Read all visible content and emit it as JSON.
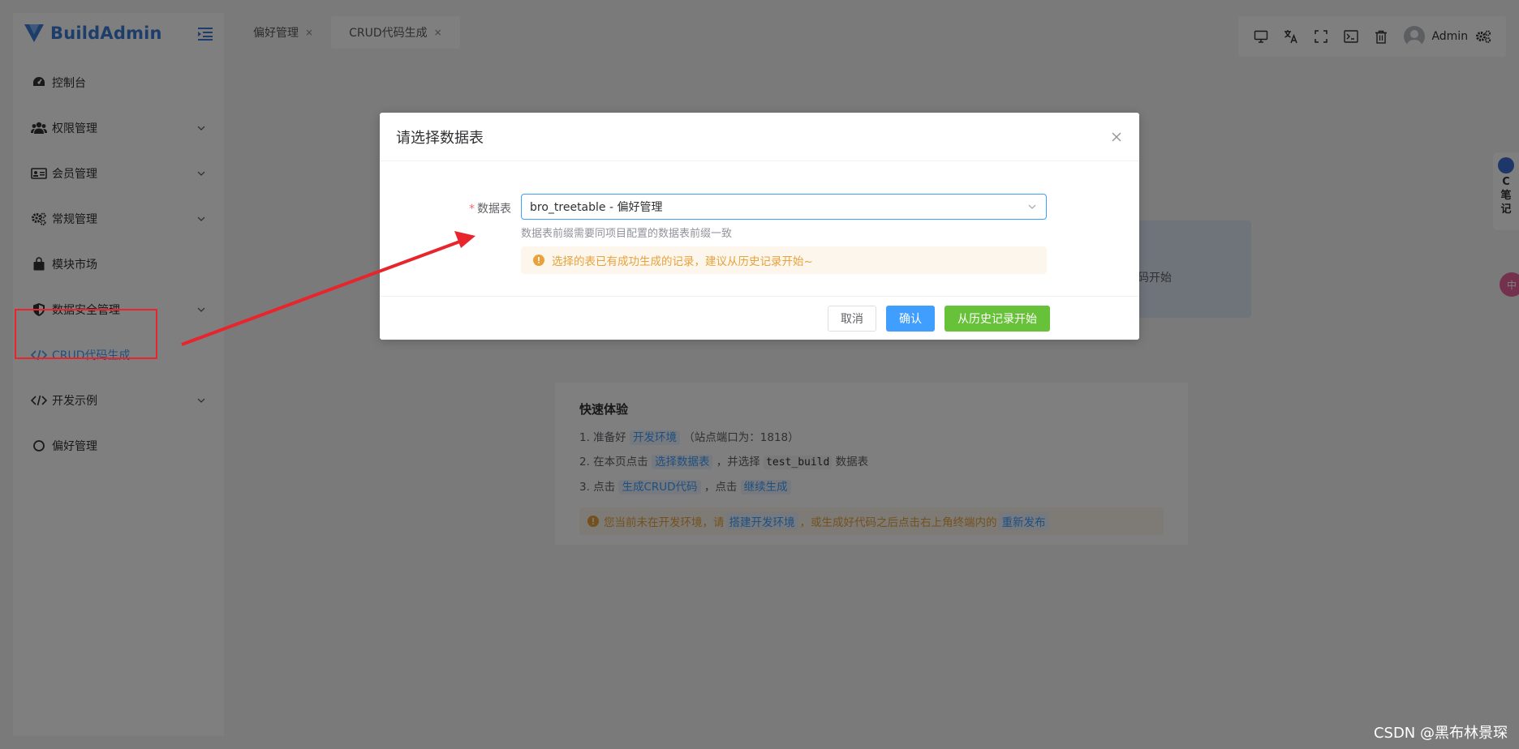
{
  "app": {
    "name": "BuildAdmin"
  },
  "sidebar": {
    "items": [
      {
        "label": "控制台",
        "icon": "dashboard-icon",
        "has_children": false
      },
      {
        "label": "权限管理",
        "icon": "users-icon",
        "has_children": true
      },
      {
        "label": "会员管理",
        "icon": "id-card-icon",
        "has_children": true
      },
      {
        "label": "常规管理",
        "icon": "gears-icon",
        "has_children": true
      },
      {
        "label": "模块市场",
        "icon": "shopping-bag-icon",
        "has_children": false
      },
      {
        "label": "数据安全管理",
        "icon": "shield-icon",
        "has_children": true
      },
      {
        "label": "CRUD代码生成",
        "icon": "code-icon",
        "has_children": false,
        "active": true
      },
      {
        "label": "开发示例",
        "icon": "code-icon",
        "has_children": true
      },
      {
        "label": "偏好管理",
        "icon": "circle-icon",
        "has_children": false
      }
    ]
  },
  "tabs": [
    {
      "label": "偏好管理",
      "close": "×"
    },
    {
      "label": "CRUD代码生成",
      "close": "×",
      "active": true
    }
  ],
  "toolbar": {
    "icons": [
      "monitor-icon",
      "translate-icon",
      "fullscreen-icon",
      "terminal-icon",
      "trash-icon"
    ],
    "user_name": "Admin",
    "settings_icon": "settings-icon"
  },
  "side_note": {
    "chars": [
      "C",
      "笔",
      "记"
    ]
  },
  "side_badge": {
    "text": "中"
  },
  "background": {
    "peek_text": "码开始",
    "quick": {
      "title": "快速体验",
      "step1": {
        "prefix": "1. 准备好",
        "link": "开发环境",
        "suffix": "（站点端口为：1818）"
      },
      "step2": {
        "prefix": "2. 在本页点击",
        "link": "选择数据表",
        "middle": "，并选择",
        "code": "test_build",
        "suffix": "数据表"
      },
      "step3": {
        "prefix": "3. 点击",
        "link1": "生成CRUD代码",
        "middle": "，点击",
        "link2": "继续生成"
      },
      "warn": {
        "prefix": "您当前未在开发环境，请",
        "link1": "搭建开发环境",
        "middle": "，或生成好代码之后点击右上角终端内的",
        "link2": "重新发布"
      }
    }
  },
  "dialog": {
    "title": "请选择数据表",
    "field_label": "数据表",
    "required_mark": "*",
    "selected_value": "bro_treetable - 偏好管理",
    "help_text": "数据表前缀需要同项目配置的数据表前缀一致",
    "alert_text": "选择的表已有成功生成的记录，建议从历史记录开始~",
    "buttons": {
      "cancel": "取消",
      "confirm": "确认",
      "history": "从历史记录开始"
    }
  },
  "colors": {
    "primary": "#409eff",
    "success": "#67c23a",
    "warning": "#e6a23c",
    "annotation": "#e8242c"
  },
  "watermark": "CSDN @黑布林景琛"
}
